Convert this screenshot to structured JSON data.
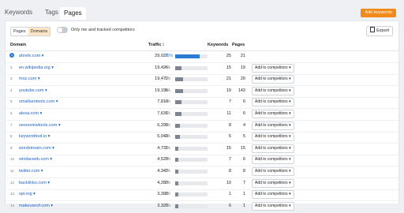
{
  "tabs": [
    {
      "label": "Keywords",
      "active": false
    },
    {
      "label": "Tags",
      "active": false
    },
    {
      "label": "Pages",
      "active": true
    }
  ],
  "add_keywords_label": "Add keywords",
  "segment": {
    "options": [
      "Pages",
      "Domains"
    ],
    "selected": "Domains"
  },
  "toggle_label": "Only me and tracked competitors",
  "export_label": "Export",
  "columns": {
    "domain": "Domain",
    "traffic": "Traffic",
    "keywords": "Keywords",
    "pages": "Pages"
  },
  "add_competitor_label": "Add to competitors ▾",
  "colors": {
    "accent": "#f28a1a",
    "link": "#1f64c4",
    "highlight": "#2b7bd5"
  },
  "rows": [
    {
      "num": "1",
      "domain": "ahrefs.com ▾",
      "traffic": "29,027",
      "pct": "15%",
      "share": 0.15,
      "keywords": "25",
      "pages": "21",
      "add": false
    },
    {
      "num": "2",
      "domain": "en.wikipedia.org ▾",
      "traffic": "19,426",
      "pct": "4%",
      "share": 0.04,
      "keywords": "15",
      "pages": "19",
      "add": true
    },
    {
      "num": "3",
      "domain": "moz.com ▾",
      "traffic": "19,472",
      "pct": "5%",
      "share": 0.05,
      "keywords": "21",
      "pages": "20",
      "add": true
    },
    {
      "num": "4",
      "domain": "youtube.com ▾",
      "traffic": "19,196",
      "pct": "5%",
      "share": 0.05,
      "keywords": "19",
      "pages": "143",
      "add": true
    },
    {
      "num": "5",
      "domain": "smallseotools.com ▾",
      "traffic": "7,818",
      "pct": "4%",
      "share": 0.04,
      "keywords": "7",
      "pages": "6",
      "add": true
    },
    {
      "num": "6",
      "domain": "alexa.com ▾",
      "traffic": "7,631",
      "pct": "4%",
      "share": 0.04,
      "keywords": "11",
      "pages": "6",
      "add": true
    },
    {
      "num": "7",
      "domain": "seoreviewtools.com ▾",
      "traffic": "6,295",
      "pct": "3%",
      "share": 0.03,
      "keywords": "8",
      "pages": "4",
      "add": true
    },
    {
      "num": "8",
      "domain": "keywordtool.io ▾",
      "traffic": "5,040",
      "pct": "3%",
      "share": 0.03,
      "keywords": "5",
      "pages": "5",
      "add": true
    },
    {
      "num": "9",
      "domain": "wordstream.com ▾",
      "traffic": "4,731",
      "pct": "2%",
      "share": 0.02,
      "keywords": "15",
      "pages": "15",
      "add": true
    },
    {
      "num": "10",
      "domain": "similarweb.com ▾",
      "traffic": "4,529",
      "pct": "2%",
      "share": 0.02,
      "keywords": "7",
      "pages": "6",
      "add": true
    },
    {
      "num": "11",
      "domain": "twitter.com ▾",
      "traffic": "4,342",
      "pct": "2%",
      "share": 0.02,
      "keywords": "8",
      "pages": "8",
      "add": true
    },
    {
      "num": "12",
      "domain": "backlinko.com ▾",
      "traffic": "4,280",
      "pct": "2%",
      "share": 0.02,
      "keywords": "10",
      "pages": "7",
      "add": true
    },
    {
      "num": "13",
      "domain": "spi.org ▾",
      "traffic": "3,398",
      "pct": "2%",
      "share": 0.02,
      "keywords": "1",
      "pages": "1",
      "add": true
    },
    {
      "num": "14",
      "domain": "makeuseof.com ▾",
      "traffic": "3,328",
      "pct": "2%",
      "share": 0.02,
      "keywords": "6",
      "pages": "1",
      "add": true
    }
  ]
}
